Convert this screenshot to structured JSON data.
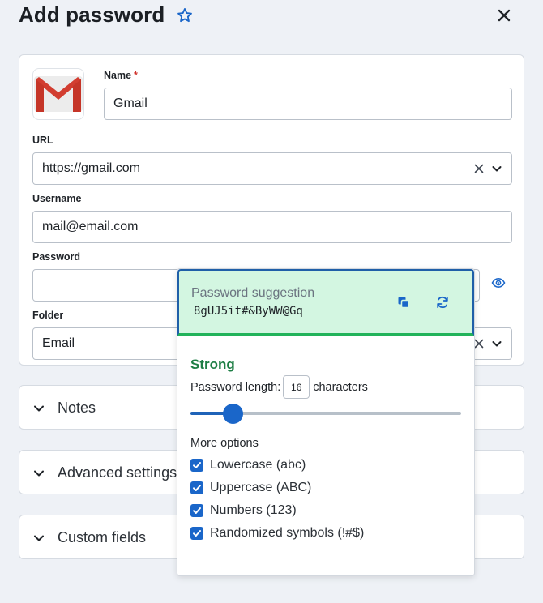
{
  "header": {
    "title": "Add password"
  },
  "form": {
    "name_label": "Name",
    "name_required_mark": "*",
    "name_value": "Gmail",
    "url_label": "URL",
    "url_value": "https://gmail.com",
    "username_label": "Username",
    "username_value": "mail@email.com",
    "password_label": "Password",
    "password_value": "",
    "folder_label": "Folder",
    "folder_value": "Email"
  },
  "sections": [
    {
      "title": "Notes"
    },
    {
      "title": "Advanced settings"
    },
    {
      "title": "Custom fields"
    }
  ],
  "generator": {
    "suggestion_title": "Password suggestion",
    "suggested_password": "8gUJ5it#&ByWW@Gq",
    "strength": "Strong",
    "length_label": "Password length:",
    "length_value": "16",
    "length_unit": "characters",
    "length_slider_fraction": 0.155,
    "more_options_label": "More options",
    "options": [
      {
        "label": "Lowercase (abc)",
        "checked": true
      },
      {
        "label": "Uppercase (ABC)",
        "checked": true
      },
      {
        "label": "Numbers (123)",
        "checked": true
      },
      {
        "label": "Randomized symbols (!#$)",
        "checked": true
      }
    ]
  },
  "colors": {
    "accent": "#1a66c9",
    "strength_green": "#1e7e45",
    "suggestion_bg": "#d3f6e1",
    "required_red": "#d0332c"
  },
  "icons": {
    "star": "star-outline-icon",
    "close": "close-icon",
    "logo": "gmail-logo",
    "copy": "copy-icon",
    "refresh": "refresh-icon",
    "reveal": "reveal-password-icon",
    "clear": "clear-icon",
    "dropdown": "chevron-down-icon",
    "expand": "chevron-down-icon",
    "checkbox": "checkmark-icon"
  }
}
